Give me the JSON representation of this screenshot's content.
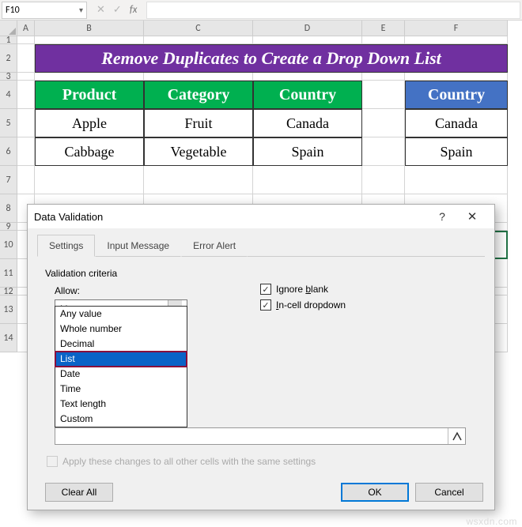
{
  "namebox": {
    "value": "F10"
  },
  "columns": [
    "A",
    "B",
    "C",
    "D",
    "E",
    "F"
  ],
  "rows": [
    "1",
    "2",
    "3",
    "4",
    "5",
    "6",
    "7",
    "8",
    "9",
    "10",
    "11",
    "12",
    "13",
    "14"
  ],
  "title": "Remove Duplicates to Create a Drop Down List",
  "table1": {
    "headers": [
      "Product",
      "Category",
      "Country"
    ],
    "rows": [
      [
        "Apple",
        "Fruit",
        "Canada"
      ],
      [
        "Cabbage",
        "Vegetable",
        "Spain"
      ]
    ]
  },
  "table2": {
    "header": "Country",
    "rows": [
      "Canada",
      "Spain"
    ]
  },
  "dialog": {
    "title": "Data Validation",
    "tabs": [
      "Settings",
      "Input Message",
      "Error Alert"
    ],
    "active_tab": 0,
    "section": "Validation criteria",
    "allow_label": "Allow:",
    "allow_value": "List",
    "allow_options": [
      "Any value",
      "Whole number",
      "Decimal",
      "List",
      "Date",
      "Time",
      "Text length",
      "Custom"
    ],
    "selected_option_index": 3,
    "ignore_blank": {
      "label": "Ignore blank",
      "checked": true
    },
    "incell_dropdown": {
      "label": "In-cell dropdown",
      "checked": true
    },
    "apply_label": "Apply these changes to all other cells with the same settings",
    "clear_all": "Clear All",
    "ok": "OK",
    "cancel": "Cancel"
  },
  "watermark": "wsxdn.com"
}
